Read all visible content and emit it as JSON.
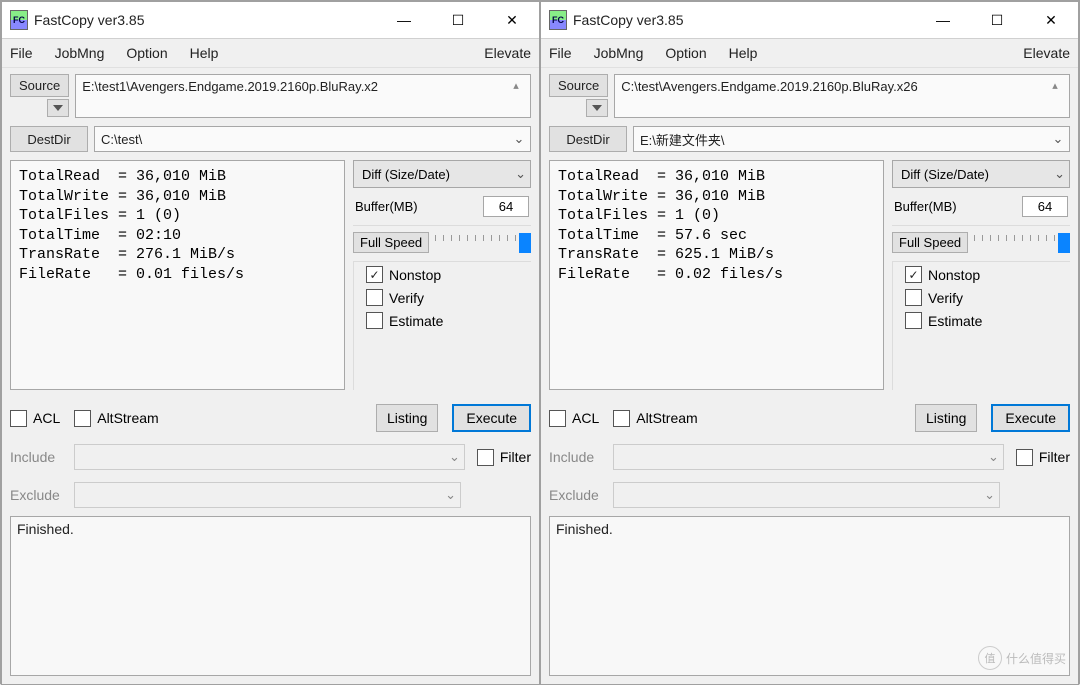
{
  "windows": [
    {
      "title": "FastCopy ver3.85",
      "menu": {
        "file": "File",
        "jobmng": "JobMng",
        "option": "Option",
        "help": "Help",
        "elevate": "Elevate"
      },
      "source_label": "Source",
      "destdir_label": "DestDir",
      "source_path": "E:\\test1\\Avengers.Endgame.2019.2160p.BluRay.x2",
      "dest_path": "C:\\test\\",
      "stats": "TotalRead  = 36,010 MiB\nTotalWrite = 36,010 MiB\nTotalFiles = 1 (0)\nTotalTime  = 02:10\nTransRate  = 276.1 MiB/s\nFileRate   = 0.01 files/s",
      "mode": "Diff (Size/Date)",
      "buffer_label": "Buffer(MB)",
      "buffer_value": "64",
      "speed_label": "Full Speed",
      "cb_nonstop": "Nonstop",
      "cb_verify": "Verify",
      "cb_estimate": "Estimate",
      "cb_acl": "ACL",
      "cb_altstream": "AltStream",
      "listing": "Listing",
      "execute": "Execute",
      "include": "Include",
      "exclude": "Exclude",
      "filter": "Filter",
      "log": "Finished."
    },
    {
      "title": "FastCopy ver3.85",
      "menu": {
        "file": "File",
        "jobmng": "JobMng",
        "option": "Option",
        "help": "Help",
        "elevate": "Elevate"
      },
      "source_label": "Source",
      "destdir_label": "DestDir",
      "source_path": "C:\\test\\Avengers.Endgame.2019.2160p.BluRay.x26",
      "dest_path": "E:\\新建文件夹\\",
      "stats": "TotalRead  = 36,010 MiB\nTotalWrite = 36,010 MiB\nTotalFiles = 1 (0)\nTotalTime  = 57.6 sec\nTransRate  = 625.1 MiB/s\nFileRate   = 0.02 files/s",
      "mode": "Diff (Size/Date)",
      "buffer_label": "Buffer(MB)",
      "buffer_value": "64",
      "speed_label": "Full Speed",
      "cb_nonstop": "Nonstop",
      "cb_verify": "Verify",
      "cb_estimate": "Estimate",
      "cb_acl": "ACL",
      "cb_altstream": "AltStream",
      "listing": "Listing",
      "execute": "Execute",
      "include": "Include",
      "exclude": "Exclude",
      "filter": "Filter",
      "log": "Finished."
    }
  ],
  "watermark": "什么值得买"
}
